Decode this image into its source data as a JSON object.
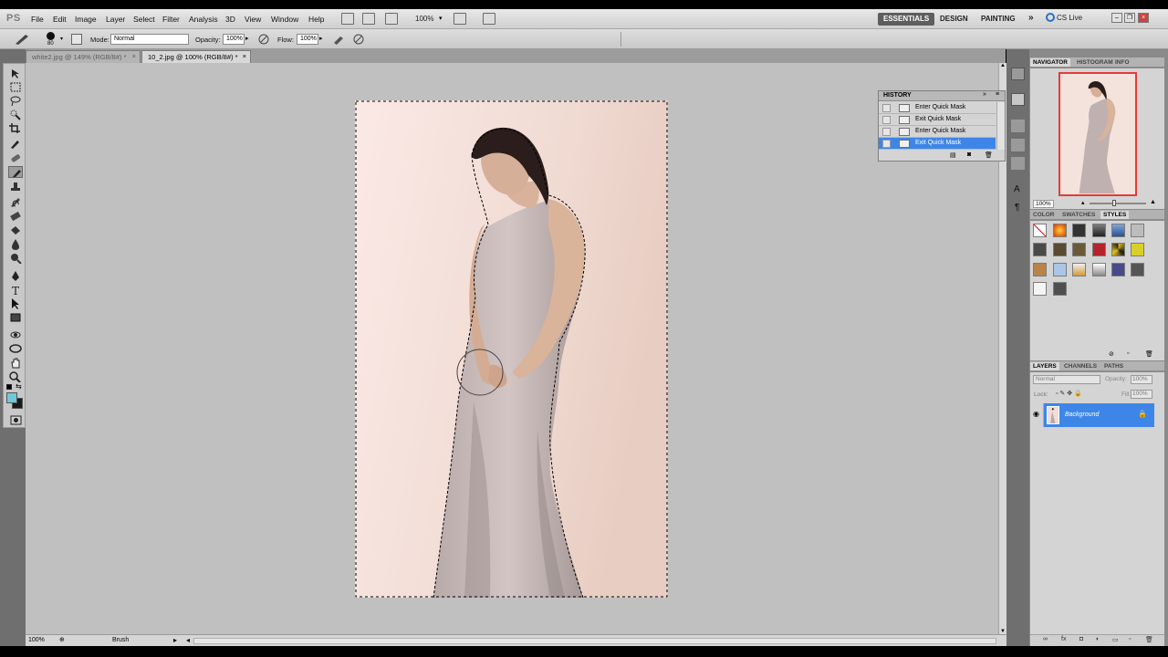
{
  "app": {
    "logo": "PS"
  },
  "menu": [
    "File",
    "Edit",
    "Image",
    "Layer",
    "Select",
    "Filter",
    "Analysis",
    "3D",
    "View",
    "Window",
    "Help"
  ],
  "zoom_dropdown": "100%",
  "workspaces": {
    "essentials": "ESSENTIALS",
    "design": "DESIGN",
    "painting": "PAINTING",
    "more": "»"
  },
  "cslive": "CS Live",
  "options": {
    "brush_size": "80",
    "mode_label": "Mode:",
    "mode_value": "Normal",
    "opacity_label": "Opacity:",
    "opacity_value": "100%",
    "flow_label": "Flow:",
    "flow_value": "100%"
  },
  "tabs": [
    {
      "label": "white2.jpg @ 149% (RGB/8#) *"
    },
    {
      "label": "10_2.jpg @ 100% (RGB/8#) *"
    }
  ],
  "history": {
    "title": "HISTORY",
    "items": [
      {
        "label": "Enter Quick Mask"
      },
      {
        "label": "Exit Quick Mask"
      },
      {
        "label": "Enter Quick Mask"
      },
      {
        "label": "Exit Quick Mask",
        "selected": true
      }
    ]
  },
  "navigator": {
    "tab1": "NAVIGATOR",
    "tab2": "HISTOGRAM",
    "tab3": "INFO",
    "zoom": "100%"
  },
  "styles_panel": {
    "tab1": "COLOR",
    "tab2": "SWATCHES",
    "tab3": "STYLES"
  },
  "layers_panel": {
    "tab1": "LAYERS",
    "tab2": "CHANNELS",
    "tab3": "PATHS",
    "blend": "Normal",
    "opacity_label": "Opacity:",
    "opacity_value": "100%",
    "lock_label": "Lock:",
    "fill_label": "Fill:",
    "fill_value": "100%",
    "layer_name": "Background"
  },
  "status": {
    "zoom": "100%",
    "info": "Brush"
  },
  "colors": {
    "selection": "#3d86e8",
    "foreground": "#6fc9d8",
    "background": "#1a1a1a"
  }
}
